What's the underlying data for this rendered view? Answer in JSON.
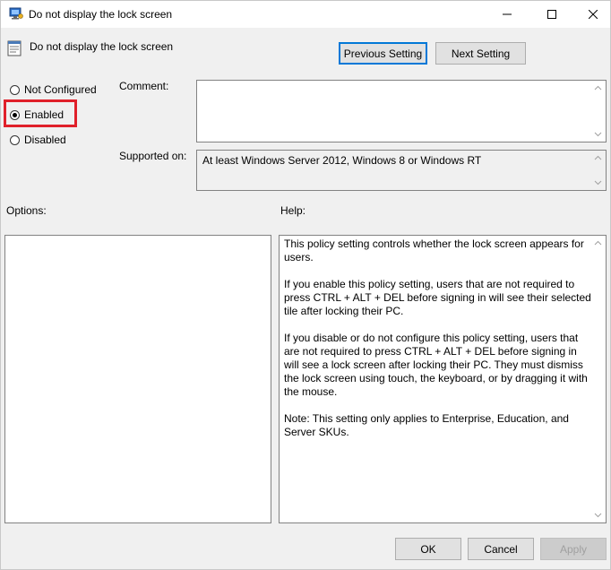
{
  "window": {
    "title": "Do not display the lock screen",
    "controls": {
      "minimize": "minimize",
      "maximize": "maximize",
      "close": "close"
    }
  },
  "header": {
    "policy_name": "Do not display the lock screen",
    "previous_label": "Previous Setting",
    "next_label": "Next Setting"
  },
  "state": {
    "options": [
      {
        "label": "Not Configured",
        "checked": false
      },
      {
        "label": "Enabled",
        "checked": true
      },
      {
        "label": "Disabled",
        "checked": false
      }
    ]
  },
  "comment": {
    "label": "Comment:",
    "value": ""
  },
  "supported": {
    "label": "Supported on:",
    "value": "At least Windows Server 2012, Windows 8 or Windows RT"
  },
  "options_panel": {
    "label": "Options:"
  },
  "help_panel": {
    "label": "Help:",
    "paragraphs": [
      "This policy setting controls whether the lock screen appears for users.",
      "If you enable this policy setting, users that are not required to press CTRL + ALT + DEL before signing in will see their selected tile after locking their PC.",
      "If you disable or do not configure this policy setting, users that are not required to press CTRL + ALT + DEL before signing in will see a lock screen after locking their PC. They must dismiss the lock screen using touch, the keyboard, or by dragging it with the mouse.",
      "Note: This setting only applies to Enterprise, Education, and Server SKUs."
    ]
  },
  "footer": {
    "ok_label": "OK",
    "cancel_label": "Cancel",
    "apply_label": "Apply"
  },
  "colors": {
    "accent": "#0078d7",
    "highlight": "#e0202a",
    "background": "#f0f0f0"
  },
  "icons": {
    "title": "group-policy-icon",
    "header": "policy-setting-icon",
    "minimize": "minimize-icon",
    "maximize": "maximize-icon",
    "close": "close-icon"
  }
}
